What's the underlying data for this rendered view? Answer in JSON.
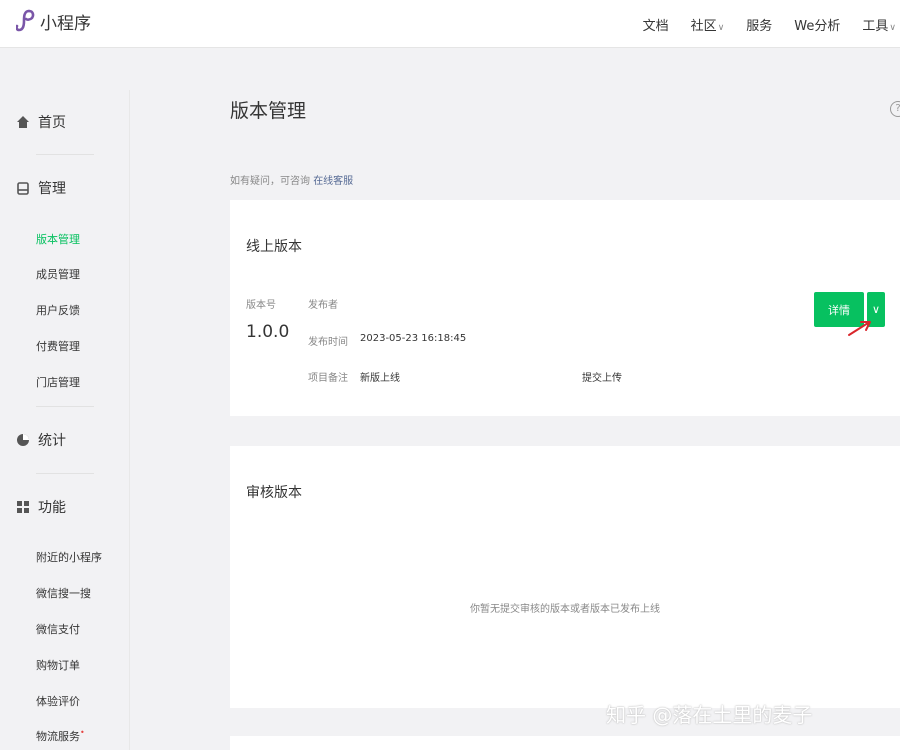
{
  "topbar": {
    "app_title": "小程序",
    "nav": [
      "文档",
      "社区",
      "服务",
      "We分析",
      "工具"
    ]
  },
  "sidebar": {
    "groups": {
      "home": "首页",
      "manage": "管理",
      "stats": "统计",
      "features": "功能"
    },
    "manage_items": [
      "版本管理",
      "成员管理",
      "用户反馈",
      "付费管理",
      "门店管理"
    ],
    "feature_items": [
      "附近的小程序",
      "微信搜一搜",
      "微信支付",
      "购物订单",
      "体验评价",
      "物流服务"
    ],
    "active_item": "版本管理"
  },
  "main": {
    "page_title": "版本管理",
    "help_symbol": "?",
    "hint_text": "如有疑问，可咨询",
    "hint_link": "在线客服",
    "online": {
      "title": "线上版本",
      "version_label": "版本号",
      "version_value": "1.0.0",
      "publisher_label": "发布者",
      "publish_time_label": "发布时间",
      "publish_time_value": "2023-05-23 16:18:45",
      "note_label": "项目备注",
      "note_value": "新版上线",
      "note_extra": "提交上传",
      "detail_button": "详情",
      "dropdown_symbol": "∨"
    },
    "review": {
      "title": "审核版本",
      "empty_text": "你暂无提交审核的版本或者版本已发布上线"
    }
  },
  "watermark": "知乎 @落在土里的麦子",
  "colors": {
    "brand_green": "#07c160",
    "link_blue": "#576b95",
    "annotation_red": "#d9262c"
  }
}
